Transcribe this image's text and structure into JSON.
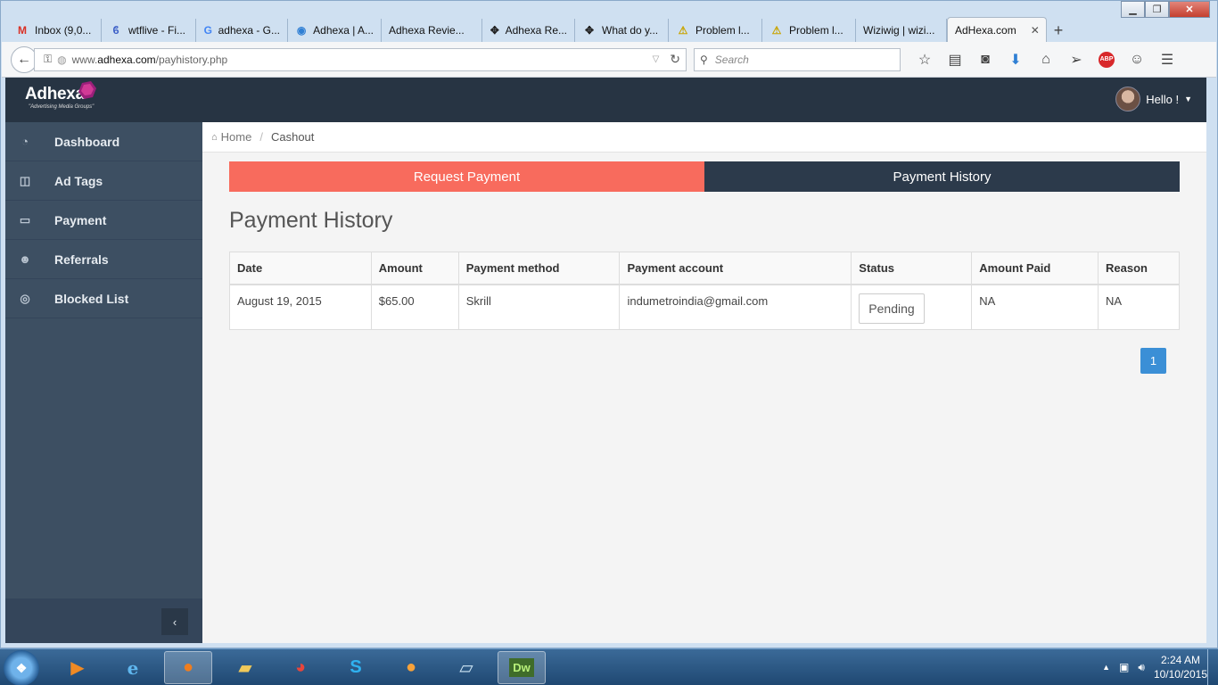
{
  "browser": {
    "tabs": [
      {
        "label": "Inbox (9,0...",
        "icon": "gmail-icon",
        "glyph": "M",
        "color": "#d93025"
      },
      {
        "label": "wtflive - Fi...",
        "icon": "wtflive-icon",
        "glyph": "ϐ",
        "color": "#3b5ec7"
      },
      {
        "label": "adhexa - G...",
        "icon": "google-icon",
        "glyph": "G",
        "color": "#4285f4"
      },
      {
        "label": "Adhexa | A...",
        "icon": "globe-icon",
        "glyph": "◉",
        "color": "#2f7fd4"
      },
      {
        "label": "Adhexa Revie...",
        "icon": "",
        "glyph": "",
        "color": "#333"
      },
      {
        "label": "Adhexa Re...",
        "icon": "diamond-icon",
        "glyph": "✥",
        "color": "#222"
      },
      {
        "label": "What do y...",
        "icon": "diamond-icon",
        "glyph": "✥",
        "color": "#222"
      },
      {
        "label": "Problem l...",
        "icon": "warning-icon",
        "glyph": "⚠",
        "color": "#c9a400"
      },
      {
        "label": "Problem l...",
        "icon": "warning-icon",
        "glyph": "⚠",
        "color": "#c9a400"
      },
      {
        "label": "Wiziwig | wizi...",
        "icon": "",
        "glyph": "",
        "color": "#333"
      }
    ],
    "active_tab": "AdHexa.com",
    "url_prefix": "www.",
    "url_domain": "adhexa.com",
    "url_path": "/payhistory.php",
    "search_placeholder": "Search"
  },
  "app": {
    "user_greeting": "Hello !",
    "logo_name": "Adhexa",
    "logo_tagline": "\"Advertising Media Groups\"",
    "sidebar": [
      {
        "label": "Dashboard",
        "icon": "dashboard-icon",
        "glyph": "◔"
      },
      {
        "label": "Ad Tags",
        "icon": "columns-icon",
        "glyph": "◫"
      },
      {
        "label": "Payment",
        "icon": "credit-card-icon",
        "glyph": "▭"
      },
      {
        "label": "Referrals",
        "icon": "users-icon",
        "glyph": "☻"
      },
      {
        "label": "Blocked List",
        "icon": "eye-slash-icon",
        "glyph": "◎"
      }
    ],
    "breadcrumb": {
      "home": "Home",
      "current": "Cashout"
    },
    "tabs": {
      "request": "Request Payment",
      "history": "Payment History"
    },
    "title": "Payment History",
    "table": {
      "headers": [
        "Date",
        "Amount",
        "Payment method",
        "Payment account",
        "Status",
        "Amount Paid",
        "Reason"
      ],
      "rows": [
        {
          "date": "August 19, 2015",
          "amount": "$65.00",
          "method": "Skrill",
          "account": "indumetroindia@gmail.com",
          "status": "Pending",
          "paid": "NA",
          "reason": "NA"
        }
      ]
    },
    "pagination": {
      "current": "1"
    }
  },
  "taskbar": {
    "time": "2:24 AM",
    "date": "10/10/2015"
  },
  "colors": {
    "request_tab": "#f86b5d",
    "history_tab": "#2c3a4b",
    "sidebar": "#3d4f62",
    "topbar": "#273443",
    "pager": "#3b8fd6"
  }
}
